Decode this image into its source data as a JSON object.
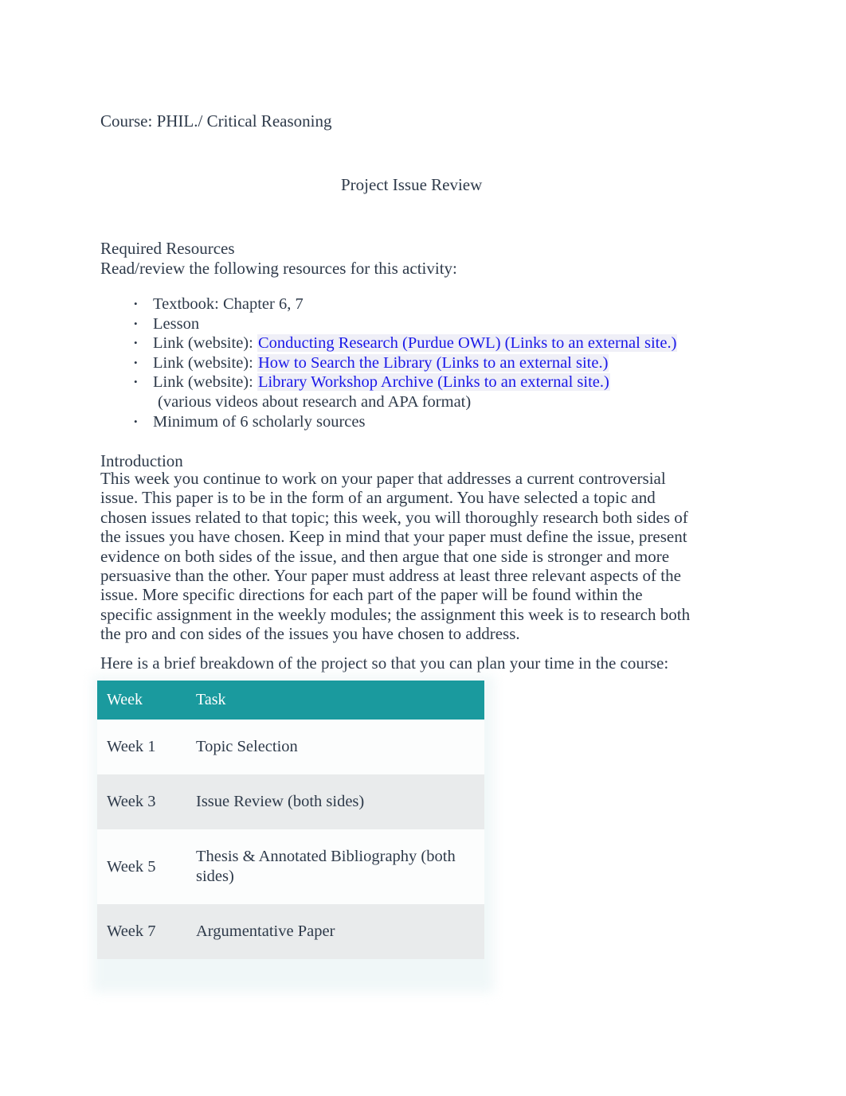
{
  "document": {
    "course_line": "Course: PHIL./ Critical Reasoning",
    "title": "Project Issue Review"
  },
  "resources": {
    "heading": "Required Resources",
    "subheading": "Read/review the following resources for this activity:",
    "items": [
      {
        "text": "Textbook: Chapter 6, 7"
      },
      {
        "text": "Lesson"
      },
      {
        "prefix": "Link (website):",
        "link": "Conducting Research (Purdue OWL) (Links to an external site.)"
      },
      {
        "prefix": "Link (website):",
        "link": "How to Search the Library (Links to an external site.)"
      },
      {
        "prefix": "Link (website):",
        "link": "Library Workshop Archive (Links to an external site.)",
        "note": "(various videos about research and APA format)"
      },
      {
        "text": "Minimum of 6 scholarly sources"
      }
    ]
  },
  "introduction": {
    "heading": "Introduction",
    "body": "This week you continue to work on your paper that addresses a current controversial issue. This paper is to be in the form of an argument. You have selected a topic and chosen issues related to that topic; this week, you will thoroughly research both sides of the issues you have chosen. Keep in mind that your paper must define the issue, present evidence on both sides of the issue, and then argue that one side is stronger and more persuasive than the other. Your paper must address at least three relevant aspects of the issue. More specific directions for each part of the paper will be found within the specific assignment in the weekly modules; the assignment this week is to research both the pro and con sides of the issues you have chosen to address."
  },
  "breakdown": {
    "lead_in": "Here is a brief breakdown of the project so that you can plan your time in the course:",
    "table": {
      "headers": [
        "Week",
        "Task"
      ],
      "rows": [
        {
          "week": "Week 1",
          "task": "Topic Selection"
        },
        {
          "week": "Week 3",
          "task": "Issue Review (both sides)"
        },
        {
          "week": "Week 5",
          "task": "Thesis & Annotated Bibliography (both sides)"
        },
        {
          "week": "Week 7",
          "task": "Argumentative Paper"
        }
      ]
    }
  },
  "colors": {
    "table_header_bg": "#1a9a9e",
    "table_header_text": "#ffffff",
    "body_text": "#2e3a4a",
    "link": "#1a18e8",
    "row_alt_bg": "#e9ebec",
    "row_bg": "#fcfdfd"
  }
}
